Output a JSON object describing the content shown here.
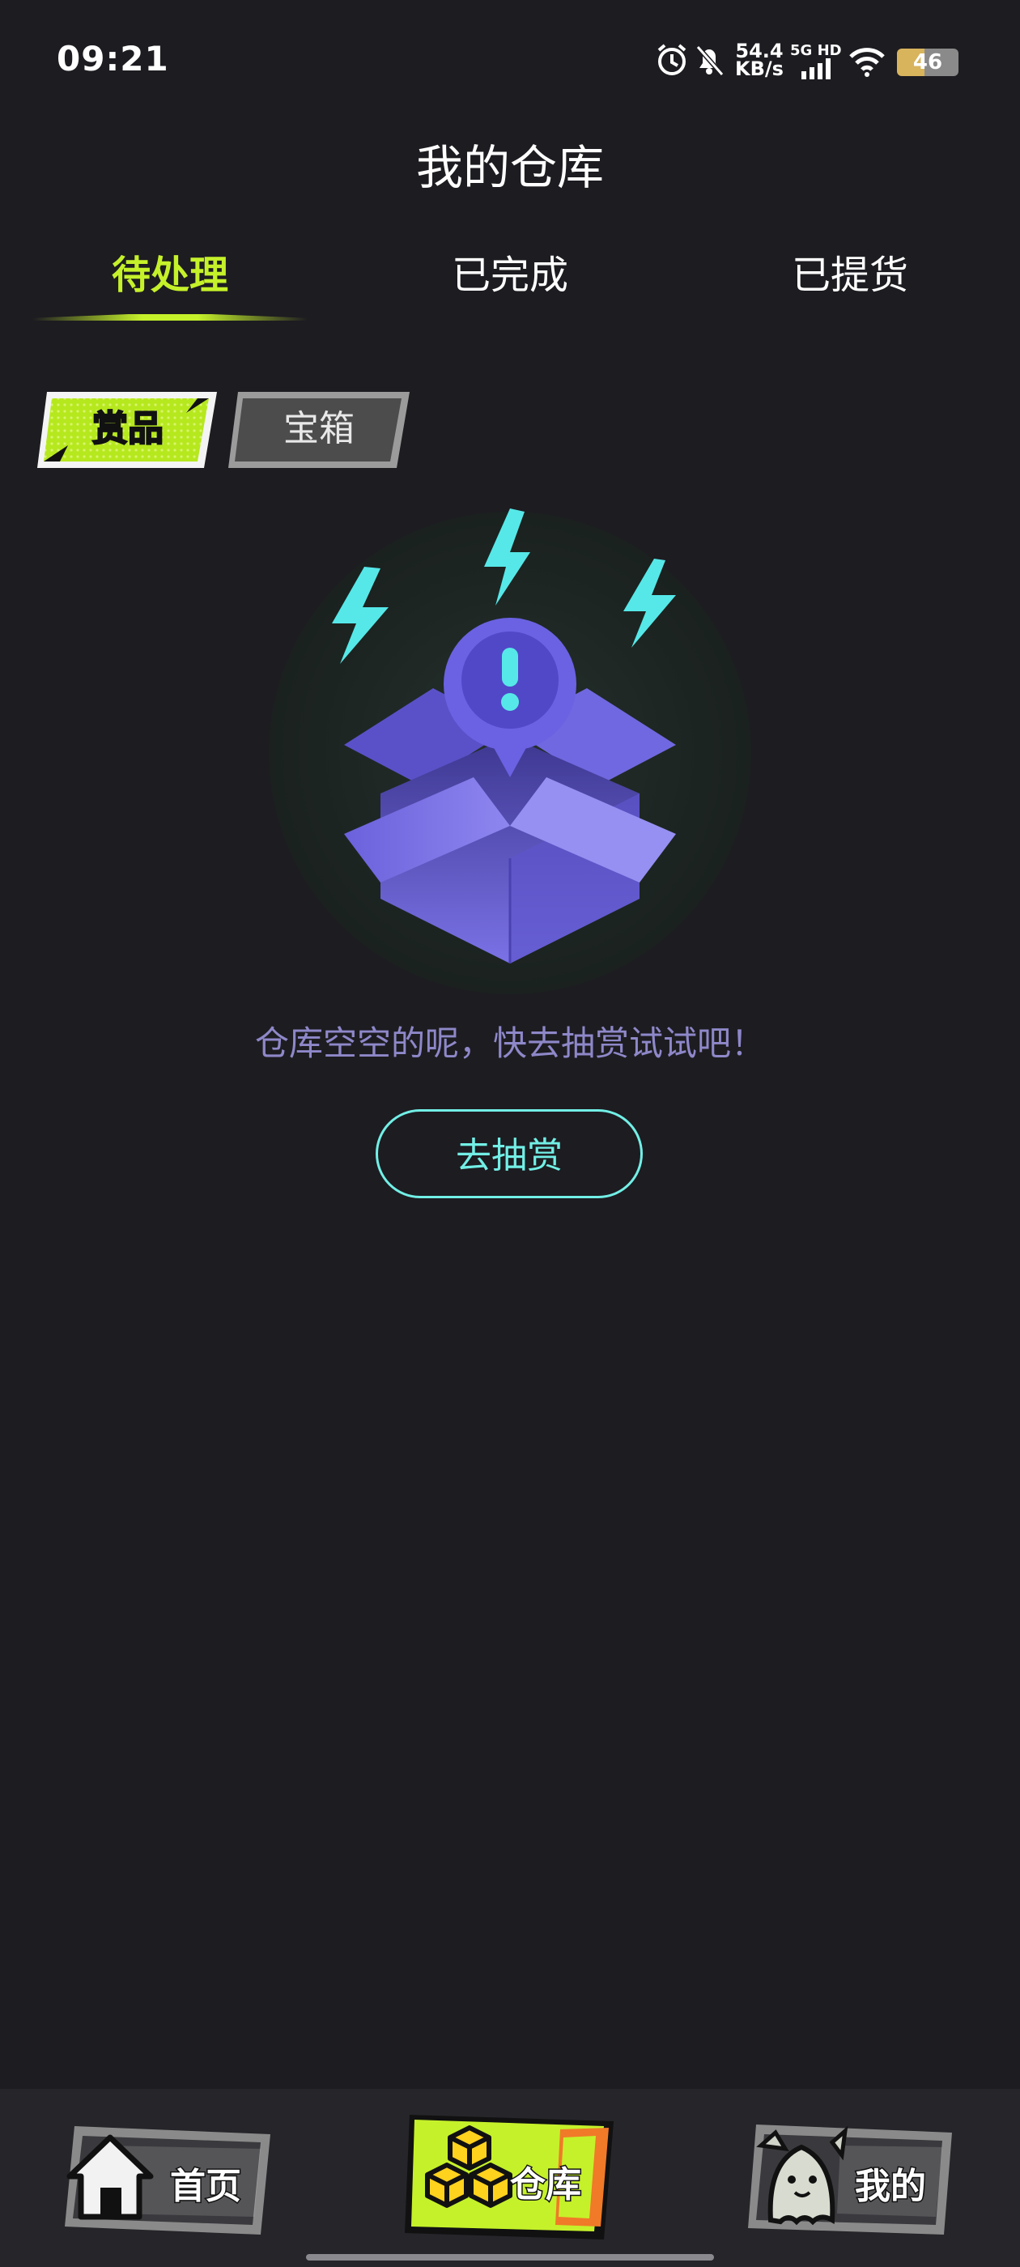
{
  "status_bar": {
    "time": "09:21",
    "net_speed_value": "54.4",
    "net_speed_unit": "KB/s",
    "network_tag": "5G HD",
    "battery": "46",
    "icons": [
      "alarm-icon",
      "mute-bell-icon",
      "signal-icon",
      "wifi-icon",
      "battery-icon"
    ]
  },
  "header": {
    "title": "我的仓库"
  },
  "tabs": [
    {
      "label": "待处理",
      "active": true
    },
    {
      "label": "已完成",
      "active": false
    },
    {
      "label": "已提货",
      "active": false
    }
  ],
  "segments": [
    {
      "label": "赏品",
      "active": true
    },
    {
      "label": "宝箱",
      "active": false
    }
  ],
  "empty_state": {
    "message": "仓库空空的呢，快去抽赏试试吧！",
    "button_label": "去抽赏",
    "illustration": "empty-box-icon"
  },
  "bottom_nav": [
    {
      "label": "首页",
      "icon": "home-icon",
      "active": false
    },
    {
      "label": "仓库",
      "icon": "warehouse-cubes-icon",
      "active": true
    },
    {
      "label": "我的",
      "icon": "ghost-avatar-icon",
      "active": false
    }
  ],
  "colors": {
    "background": "#1d1c21",
    "accent_lime": "#c5f12a",
    "accent_cyan": "#72efe6",
    "empty_text": "#8e88c9"
  }
}
